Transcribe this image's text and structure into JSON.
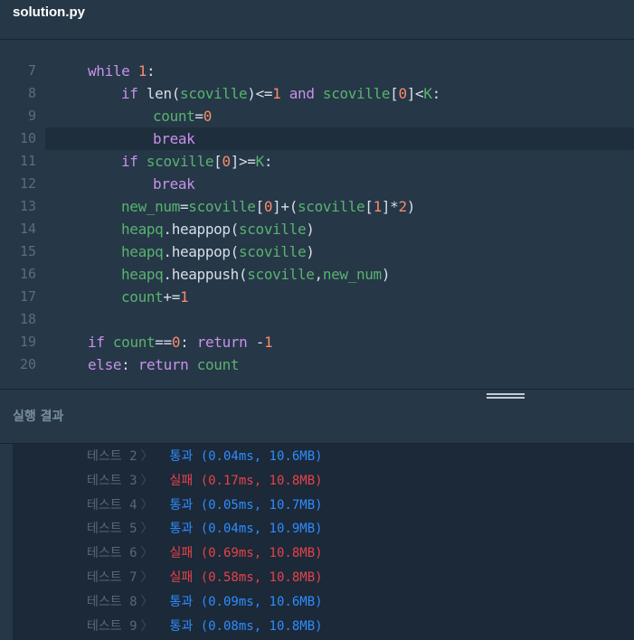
{
  "file": {
    "title": "solution.py"
  },
  "editor": {
    "active_line": "10",
    "lines": [
      {
        "num": "7",
        "indent": 0,
        "tokens": [
          [
            "kw",
            "while"
          ],
          [
            "op",
            " "
          ],
          [
            "num",
            "1"
          ],
          [
            "op",
            ":"
          ]
        ]
      },
      {
        "num": "8",
        "indent": 1,
        "tokens": [
          [
            "kw",
            "if"
          ],
          [
            "op",
            " "
          ],
          [
            "fn",
            "len"
          ],
          [
            "op",
            "("
          ],
          [
            "var",
            "scoville"
          ],
          [
            "op",
            ")<="
          ],
          [
            "num",
            "1"
          ],
          [
            "op",
            " "
          ],
          [
            "kw",
            "and"
          ],
          [
            "op",
            " "
          ],
          [
            "var",
            "scoville"
          ],
          [
            "op",
            "["
          ],
          [
            "num",
            "0"
          ],
          [
            "op",
            "]<"
          ],
          [
            "var",
            "K"
          ],
          [
            "op",
            ":"
          ]
        ]
      },
      {
        "num": "9",
        "indent": 2,
        "tokens": [
          [
            "var",
            "count"
          ],
          [
            "op",
            "="
          ],
          [
            "num",
            "0"
          ]
        ]
      },
      {
        "num": "10",
        "indent": 2,
        "tokens": [
          [
            "kw",
            "break"
          ]
        ]
      },
      {
        "num": "11",
        "indent": 1,
        "tokens": [
          [
            "kw",
            "if"
          ],
          [
            "op",
            " "
          ],
          [
            "var",
            "scoville"
          ],
          [
            "op",
            "["
          ],
          [
            "num",
            "0"
          ],
          [
            "op",
            "]>="
          ],
          [
            "var",
            "K"
          ],
          [
            "op",
            ":"
          ]
        ]
      },
      {
        "num": "12",
        "indent": 2,
        "tokens": [
          [
            "kw",
            "break"
          ]
        ]
      },
      {
        "num": "13",
        "indent": 1,
        "tokens": [
          [
            "var",
            "new_num"
          ],
          [
            "op",
            "="
          ],
          [
            "var",
            "scoville"
          ],
          [
            "op",
            "["
          ],
          [
            "num",
            "0"
          ],
          [
            "op",
            "]+("
          ],
          [
            "var",
            "scoville"
          ],
          [
            "op",
            "["
          ],
          [
            "num",
            "1"
          ],
          [
            "op",
            "]*"
          ],
          [
            "num",
            "2"
          ],
          [
            "op",
            ")"
          ]
        ]
      },
      {
        "num": "14",
        "indent": 1,
        "tokens": [
          [
            "var",
            "heapq"
          ],
          [
            "op",
            ".heappop("
          ],
          [
            "var",
            "scoville"
          ],
          [
            "op",
            ")"
          ]
        ]
      },
      {
        "num": "15",
        "indent": 1,
        "tokens": [
          [
            "var",
            "heapq"
          ],
          [
            "op",
            ".heappop("
          ],
          [
            "var",
            "scoville"
          ],
          [
            "op",
            ")"
          ]
        ]
      },
      {
        "num": "16",
        "indent": 1,
        "tokens": [
          [
            "var",
            "heapq"
          ],
          [
            "op",
            ".heappush("
          ],
          [
            "var",
            "scoville"
          ],
          [
            "op",
            ","
          ],
          [
            "var",
            "new_num"
          ],
          [
            "op",
            ")"
          ]
        ]
      },
      {
        "num": "17",
        "indent": 1,
        "tokens": [
          [
            "var",
            "count"
          ],
          [
            "op",
            "+="
          ],
          [
            "num",
            "1"
          ]
        ]
      },
      {
        "num": "18",
        "indent": 0,
        "tokens": []
      },
      {
        "num": "19",
        "indent": 0,
        "tokens": [
          [
            "kw",
            "if"
          ],
          [
            "op",
            " "
          ],
          [
            "var",
            "count"
          ],
          [
            "op",
            "=="
          ],
          [
            "num",
            "0"
          ],
          [
            "op",
            ": "
          ],
          [
            "kw",
            "return"
          ],
          [
            "op",
            " -"
          ],
          [
            "num",
            "1"
          ]
        ]
      },
      {
        "num": "20",
        "indent": 0,
        "tokens": [
          [
            "kw",
            "else"
          ],
          [
            "op",
            ": "
          ],
          [
            "kw",
            "return"
          ],
          [
            "op",
            " "
          ],
          [
            "var",
            "count"
          ]
        ]
      }
    ]
  },
  "results": {
    "title": "실행 결과",
    "rows": [
      {
        "name": "테스트 2",
        "status": "통과",
        "detail": "(0.04ms, 10.6MB)",
        "passed": true
      },
      {
        "name": "테스트 3",
        "status": "실패",
        "detail": "(0.17ms, 10.8MB)",
        "passed": false
      },
      {
        "name": "테스트 4",
        "status": "통과",
        "detail": "(0.05ms, 10.7MB)",
        "passed": true
      },
      {
        "name": "테스트 5",
        "status": "통과",
        "detail": "(0.04ms, 10.9MB)",
        "passed": true
      },
      {
        "name": "테스트 6",
        "status": "실패",
        "detail": "(0.69ms, 10.8MB)",
        "passed": false
      },
      {
        "name": "테스트 7",
        "status": "실패",
        "detail": "(0.58ms, 10.8MB)",
        "passed": false
      },
      {
        "name": "테스트 8",
        "status": "통과",
        "detail": "(0.09ms, 10.6MB)",
        "passed": true
      },
      {
        "name": "테스트 9",
        "status": "통과",
        "detail": "(0.08ms, 10.8MB)",
        "passed": true
      }
    ]
  },
  "colors": {
    "background": "#263747",
    "results_background": "#1b2938",
    "pass": "#2f8cff",
    "fail": "#e7424a",
    "keyword": "#c792ea",
    "number": "#f78c6c",
    "identifier": "#59b370"
  }
}
